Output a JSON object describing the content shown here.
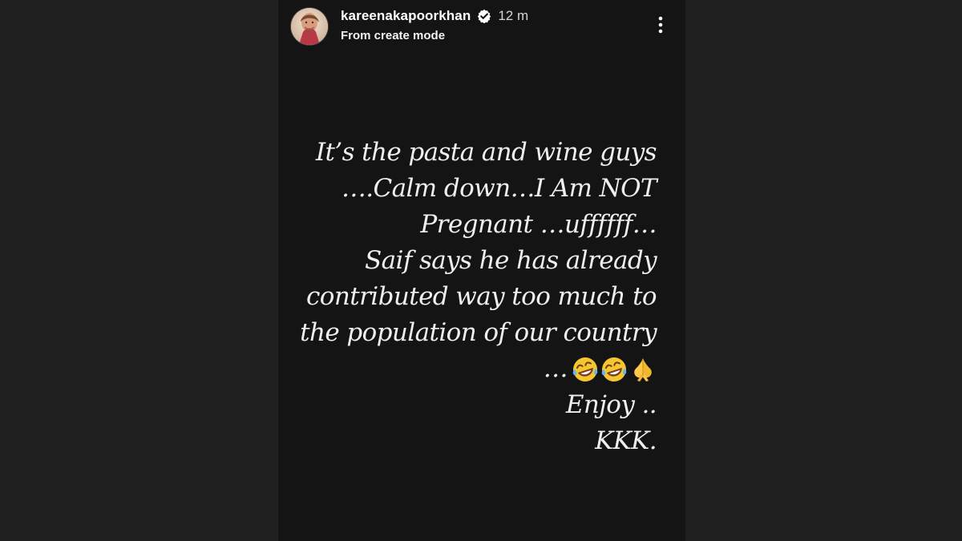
{
  "story": {
    "username": "kareenakapoorkhan",
    "time": "12 m",
    "subtitle": "From create mode",
    "icons": {
      "avatar": "profile-avatar",
      "verified": "verified-badge-icon",
      "more": "more-vertical-icon"
    },
    "text_lines": [
      "It’s the pasta and wine guys",
      "….Calm down…I Am NOT",
      "Pregnant …uffffff…",
      "Saif says he has already",
      "contributed way too much to",
      "the population of our country",
      "…",
      "Enjoy ..",
      "KKK."
    ],
    "emoji_names": [
      "rolling-on-floor-laughing-emoji",
      "rolling-on-floor-laughing-emoji",
      "folded-hands-emoji"
    ],
    "colors": {
      "background": "#202020",
      "story_background": "#141414",
      "text": "#efefef",
      "verified_badge": "#ffffff"
    }
  }
}
